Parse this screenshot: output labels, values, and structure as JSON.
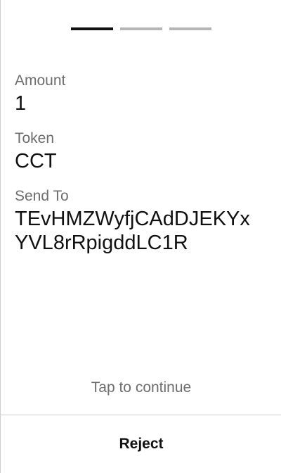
{
  "steps": {
    "total": 3,
    "current": 1
  },
  "details": {
    "amount_label": "Amount",
    "amount_value": "1",
    "token_label": "Token",
    "token_value": "CCT",
    "send_to_label": "Send To",
    "send_to_value": "TEvHMZWyfjCAdDJEKYxYVL8rRpigddLC1R"
  },
  "actions": {
    "tap_hint": "Tap to continue",
    "reject_label": "Reject"
  },
  "colors": {
    "step_active": "#111111",
    "step_inactive": "#b6b6b6",
    "label_text": "#6d6d6d",
    "value_text": "#111111",
    "divider": "#cfcfcf"
  }
}
